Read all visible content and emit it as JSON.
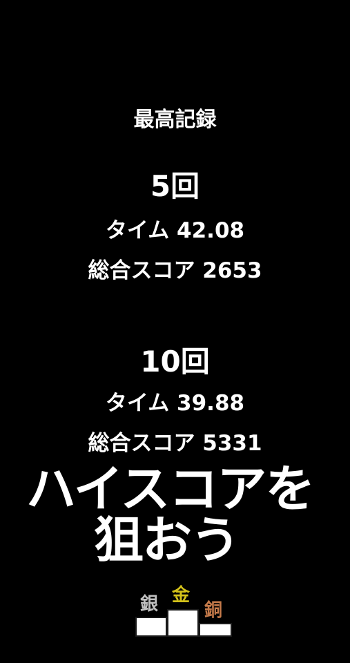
{
  "records": {
    "title": "最高記録",
    "entries": [
      {
        "heading": "5回",
        "time": "タイム 42.08",
        "score": "総合スコア 2653"
      },
      {
        "heading": "10回",
        "time": "タイム 39.88",
        "score": "総合スコア 5331"
      }
    ]
  },
  "catchphrase": {
    "line1": "ハイスコアを",
    "line2": "狙おう"
  },
  "podium": {
    "medals": [
      {
        "label": "銀",
        "color": "#c0c0c0"
      },
      {
        "label": "金",
        "color": "#d4c21a"
      },
      {
        "label": "銅",
        "color": "#c47a4a"
      }
    ]
  },
  "colors": {
    "background": "#000000",
    "text": "#ffffff"
  }
}
